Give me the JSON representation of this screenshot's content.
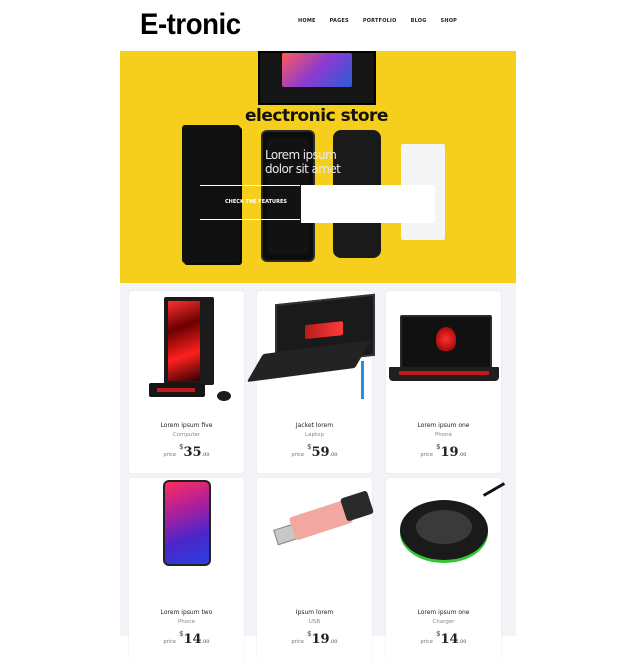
{
  "header": {
    "logo": "E-tronic",
    "nav": [
      "HOME",
      "PAGES",
      "PORTFOLIO",
      "BLOG",
      "SHOP"
    ]
  },
  "hero": {
    "title": "electronic store",
    "subtitle": "Lorem ipsum dolor sit amet",
    "cta": "CHECK THE FEATURES"
  },
  "products": [
    {
      "name": "Lorem ipsum five",
      "category": "Computer",
      "price_label": "price",
      "currency": "$",
      "price": "35",
      "cents": ".00"
    },
    {
      "name": "Jacket lorem",
      "category": "Laptop",
      "price_label": "price",
      "currency": "$",
      "price": "59",
      "cents": ".00"
    },
    {
      "name": "Lorem ipsum one",
      "category": "Phone",
      "price_label": "price",
      "currency": "$",
      "price": "19",
      "cents": ".00"
    },
    {
      "name": "Lorem ipsum two",
      "category": "Phone",
      "price_label": "price",
      "currency": "$",
      "price": "14",
      "cents": ".00"
    },
    {
      "name": "Ipsum lorem",
      "category": "USB",
      "price_label": "price",
      "currency": "$",
      "price": "19",
      "cents": ".00"
    },
    {
      "name": "Lorem ipsum one",
      "category": "Charger",
      "price_label": "price",
      "currency": "$",
      "price": "14",
      "cents": ".00"
    }
  ],
  "colors": {
    "hero_bg": "#f6cf1d",
    "products_bg": "#f3f4f8"
  }
}
